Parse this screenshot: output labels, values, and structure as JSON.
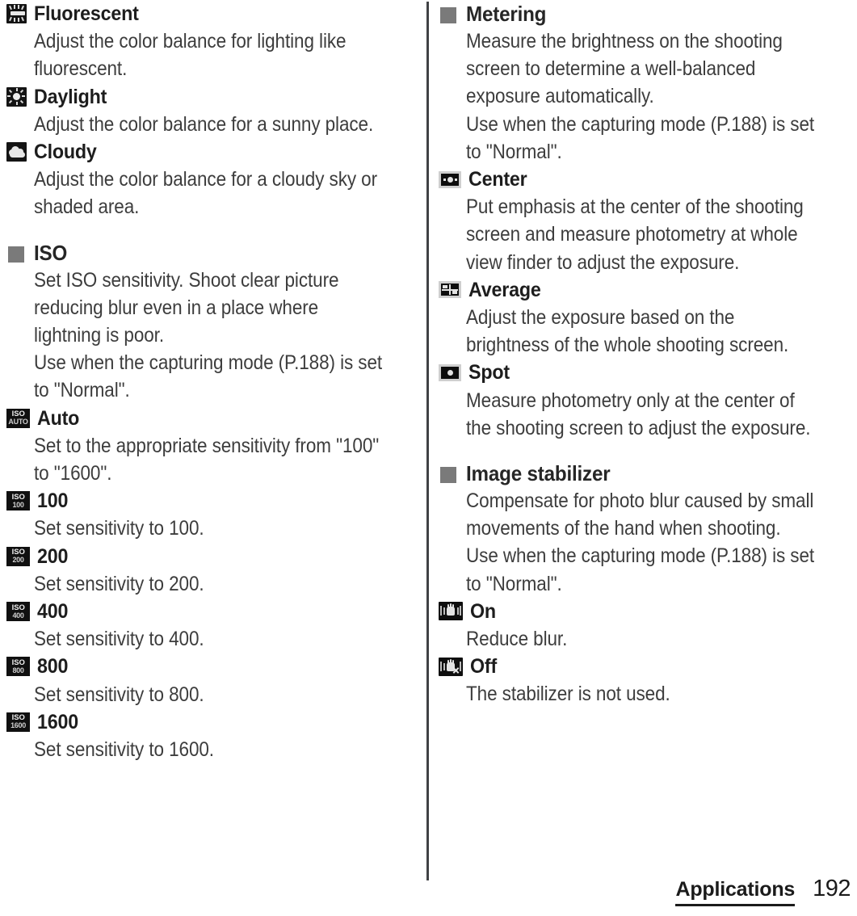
{
  "page": {
    "number": "192",
    "chapter": "Applications",
    "background": "#ffffff",
    "text_color": "#3b3b3b",
    "bullet_color": "#7a7a7a",
    "divider_color": "#404245"
  },
  "left_column": {
    "continued_options": [
      {
        "icon": "fluorescent-icon",
        "label": "Fluorescent",
        "description": [
          "Adjust the color balance for lighting like",
          "fluorescent."
        ]
      },
      {
        "icon": "daylight-sun-icon",
        "label": "Daylight",
        "description": [
          "Adjust the color balance for a sunny place."
        ]
      },
      {
        "icon": "cloudy-icon",
        "label": "Cloudy",
        "description": [
          "Adjust the color balance for a cloudy sky or",
          "shaded area."
        ]
      }
    ],
    "sections": [
      {
        "title": "ISO",
        "description": [
          "Set ISO sensitivity. Shoot clear picture",
          "reducing blur even in a place where",
          "lightning is poor.",
          "Use when the capturing mode (P.188) is set",
          "to \"Normal\"."
        ],
        "options": [
          {
            "icon": "iso-auto-icon",
            "icon_top": "ISO",
            "icon_bottom": "AUTO",
            "label": "Auto",
            "description": [
              "Set to the appropriate sensitivity from \"100\"",
              "to \"1600\"."
            ]
          },
          {
            "icon": "iso-100-icon",
            "icon_top": "ISO",
            "icon_bottom": "100",
            "label": "100",
            "description": [
              "Set sensitivity to 100."
            ]
          },
          {
            "icon": "iso-200-icon",
            "icon_top": "ISO",
            "icon_bottom": "200",
            "label": "200",
            "description": [
              "Set sensitivity to 200."
            ]
          },
          {
            "icon": "iso-400-icon",
            "icon_top": "ISO",
            "icon_bottom": "400",
            "label": "400",
            "description": [
              "Set sensitivity to 400."
            ]
          },
          {
            "icon": "iso-800-icon",
            "icon_top": "ISO",
            "icon_bottom": "800",
            "label": "800",
            "description": [
              "Set sensitivity to 800."
            ]
          },
          {
            "icon": "iso-1600-icon",
            "icon_top": "ISO",
            "icon_bottom": "1600",
            "label": "1600",
            "description": [
              "Set sensitivity to 1600."
            ]
          }
        ]
      }
    ]
  },
  "right_column": {
    "sections": [
      {
        "title": "Metering",
        "description": [
          "Measure the brightness on the shooting",
          "screen to determine a well-balanced",
          "exposure automatically.",
          "Use when the capturing mode (P.188) is set",
          "to \"Normal\"."
        ],
        "options": [
          {
            "icon": "metering-center-icon",
            "label": "Center",
            "description": [
              "Put emphasis at the center of the shooting",
              "screen and measure photometry at whole",
              "view finder to adjust the exposure."
            ]
          },
          {
            "icon": "metering-average-icon",
            "label": "Average",
            "description": [
              "Adjust the exposure based on the",
              "brightness of the whole shooting screen."
            ]
          },
          {
            "icon": "metering-spot-icon",
            "label": "Spot",
            "description": [
              "Measure photometry only at the center of",
              "the shooting screen to adjust the exposure."
            ]
          }
        ]
      },
      {
        "title": "Image stabilizer",
        "description": [
          "Compensate for photo blur caused by small",
          "movements of the hand when shooting.",
          "Use when the capturing mode (P.188) is set",
          "to \"Normal\"."
        ],
        "options": [
          {
            "icon": "stabilizer-on-icon",
            "label": "On",
            "description": [
              "Reduce blur."
            ]
          },
          {
            "icon": "stabilizer-off-icon",
            "label": "Off",
            "description": [
              "The stabilizer is not used."
            ]
          }
        ]
      }
    ]
  }
}
